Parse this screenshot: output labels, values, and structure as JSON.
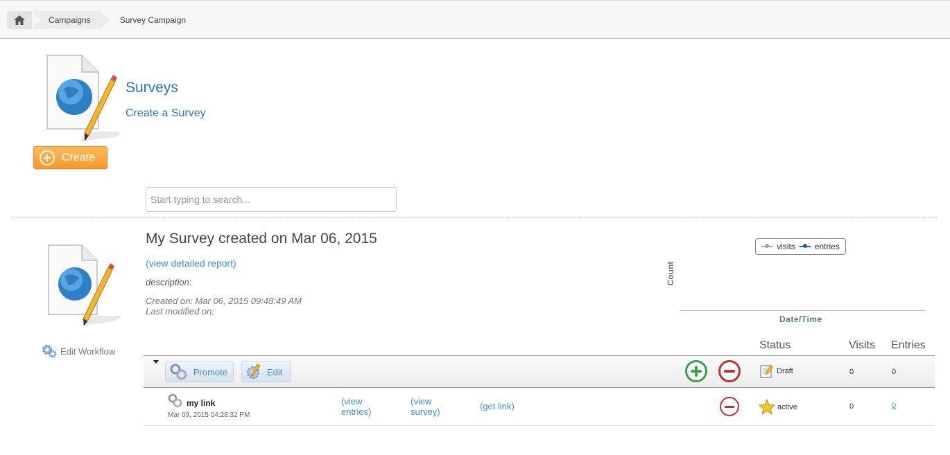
{
  "breadcrumb": {
    "home_icon": "home-icon",
    "items": [
      "Campaigns",
      "Survey Campaign"
    ]
  },
  "header": {
    "title": "Surveys",
    "subtitle": "Create a Survey",
    "create_label": "Create"
  },
  "search": {
    "placeholder": "Start typing to search..."
  },
  "survey": {
    "title": "My Survey created on Mar 06, 2015",
    "report_link": "(view detailed report)",
    "description_label": "description:",
    "created": "Created on: Mar 06, 2015 09:48:49 AM",
    "modified": "Last modified on:",
    "edit_workflow": "Edit Workflow"
  },
  "chart": {
    "legend": [
      "visits",
      "entries"
    ],
    "ylabel": "Count",
    "xlabel": "Date/Time",
    "colors": {
      "visits": "#8aa8c8",
      "entries": "#2f5f9a"
    }
  },
  "table": {
    "columns": [
      "Status",
      "Visits",
      "Entries"
    ],
    "main_row": {
      "promote_label": "Promote",
      "edit_label": "Edit",
      "status": "Draft",
      "visits": "0",
      "entries": "0"
    },
    "link_row": {
      "name": "my link",
      "date": "Mar 09, 2015 04:28:32 PM",
      "view_entries_1": "(view",
      "view_entries_2": "entries)",
      "view_survey_1": "(view",
      "view_survey_2": "survey)",
      "get_link": "(get link)",
      "status": "active",
      "visits": "0",
      "entries": "0"
    }
  }
}
